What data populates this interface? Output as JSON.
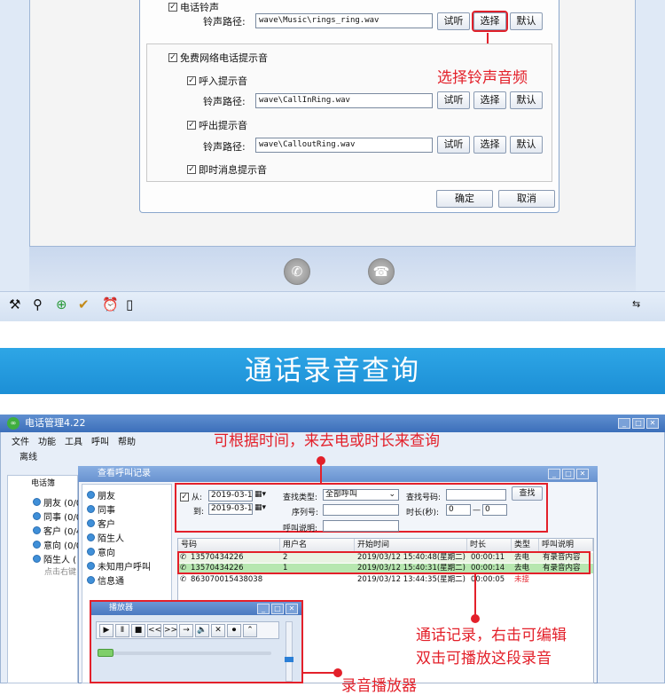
{
  "top": {
    "phone_ring_label": "电话铃声",
    "path_label": "铃声路径:",
    "phone_ring_path": "wave\\Music\\rings_ring.wav",
    "try_label": "试听",
    "select_label": "选择",
    "default_label": "默认",
    "voip_label": "免费网络电话提示音",
    "incoming_label": "呼入提示音",
    "incoming_path": "wave\\CallInRing.wav",
    "outgoing_label": "呼出提示音",
    "outgoing_path": "wave\\CalloutRing.wav",
    "im_label": "即时消息提示音",
    "ok_label": "确定",
    "cancel_label": "取消",
    "annotation_select": "选择铃声音频",
    "toolbar_icons": [
      "tools-icon",
      "search-icon",
      "add-icon",
      "check-icon",
      "alarm-clock-icon",
      "clipboard-icon"
    ],
    "swap_icon": "swap-icon"
  },
  "banner": {
    "title": "通话录音查询"
  },
  "app": {
    "window_title": "电话管理4.22",
    "menus": [
      "文件",
      "功能",
      "工具",
      "呼叫",
      "帮助"
    ],
    "status": "离线",
    "phonebook_tab": "电话簿",
    "contacts": [
      "朋友 (0/0",
      "同事 (0/0",
      "客户 (0/4",
      "意向 (0/0",
      "陌生人 ("
    ],
    "contacts_hint": "点击右键"
  },
  "records": {
    "window_title": "查看呼叫记录",
    "groups": [
      "朋友",
      "同事",
      "客户",
      "陌生人",
      "意向",
      "未知用户呼叫",
      "信息通"
    ],
    "from_label": "从:",
    "from_date": "2019-03-11",
    "to_label": "到:",
    "to_date": "2019-03-12",
    "search_type_label": "查找类型:",
    "search_type_value": "全部呼叫",
    "search_number_label": "查找号码:",
    "search_button": "查找",
    "serial_label": "序列号:",
    "duration_label": "时长(秒):",
    "duration_from": "0",
    "duration_sep": "—",
    "duration_to": "0",
    "note_label": "呼叫说明:",
    "columns": [
      "号码",
      "用户名",
      "开始时间",
      "时长",
      "类型",
      "呼叫说明"
    ],
    "rows": [
      {
        "number": "13570434226",
        "user": "2",
        "start": "2019/03/12 15:40:48(星期二)",
        "duration": "00:00:11",
        "type": "去电",
        "note": "有录音内容"
      },
      {
        "number": "13570434226",
        "user": "1",
        "start": "2019/03/12 15:40:31(星期二)",
        "duration": "00:00:14",
        "type": "去电",
        "note": "有录音内容"
      },
      {
        "number": "863070015438038",
        "user": "",
        "start": "2019/03/12 13:44:35(星期二)",
        "duration": "00:00:05",
        "type": "未接",
        "note": ""
      }
    ]
  },
  "player": {
    "title": "播放器",
    "controls": [
      "▶",
      "Ⅱ",
      "■",
      "<<",
      ">>",
      "→"
    ]
  },
  "annotations": {
    "query": "可根据时间，来去电或时长来查询",
    "record_line1": "通话记录，右击可编辑",
    "record_line2": "双击可播放这段录音",
    "player": "录音播放器"
  },
  "colors": {
    "accent_red": "#e3202a",
    "banner_blue": "#2ea6e6"
  }
}
